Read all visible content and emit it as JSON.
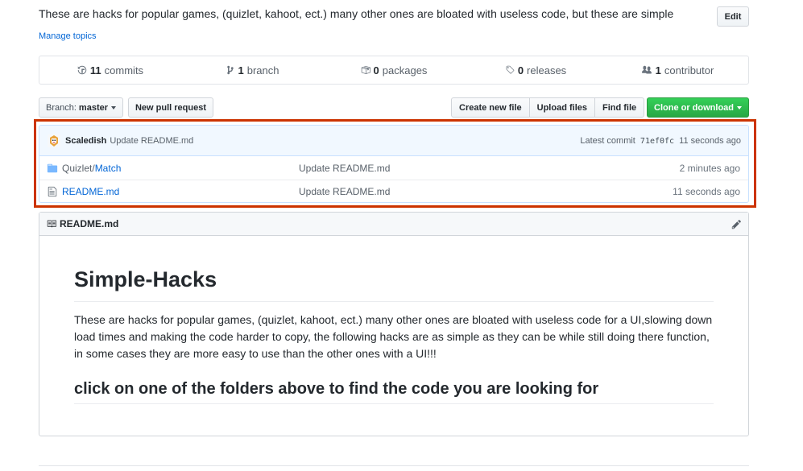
{
  "repo": {
    "description": "These are hacks for popular games, (quizlet, kahoot, ect.) many other ones are bloated with useless code, but these are simple",
    "edit_label": "Edit",
    "manage_topics": "Manage topics"
  },
  "summary": {
    "commits_count": "11",
    "commits_label": "commits",
    "branch_count": "1",
    "branch_label": "branch",
    "packages_count": "0",
    "packages_label": "packages",
    "releases_count": "0",
    "releases_label": "releases",
    "contributor_count": "1",
    "contributor_label": "contributor"
  },
  "toolbar": {
    "branch_prefix": "Branch:",
    "branch_name": "master",
    "new_pull_request": "New pull request",
    "create_new_file": "Create new file",
    "upload_files": "Upload files",
    "find_file": "Find file",
    "clone_or_download": "Clone or download"
  },
  "commit": {
    "author": "Scaledish",
    "message": "Update README.md",
    "latest_label": "Latest commit",
    "sha": "71ef0fc",
    "age": "11 seconds ago"
  },
  "files": [
    {
      "dir_prefix": "Quizlet/",
      "name": "Match",
      "message": "Update README.md",
      "age": "2 minutes ago",
      "icon": "folder-icon"
    },
    {
      "dir_prefix": "",
      "name": "README.md",
      "message": "Update README.md",
      "age": "11 seconds ago",
      "icon": "file-icon"
    }
  ],
  "readme": {
    "header": "README.md",
    "title": "Simple-Hacks",
    "body": "These are hacks for popular games, (quizlet, kahoot, ect.) many other ones are bloated with useless code for a UI,slowing down load times and making the code harder to copy, the following hacks are as simple as they can be while still doing there function, in some cases they are more easy to use than the other ones with a UI!!!",
    "subheading": "click on one of the folders above to find the code you are looking for"
  },
  "colors": {
    "link": "#0366d6",
    "highlight": "#cc3300",
    "primary_button": "#28a745"
  }
}
